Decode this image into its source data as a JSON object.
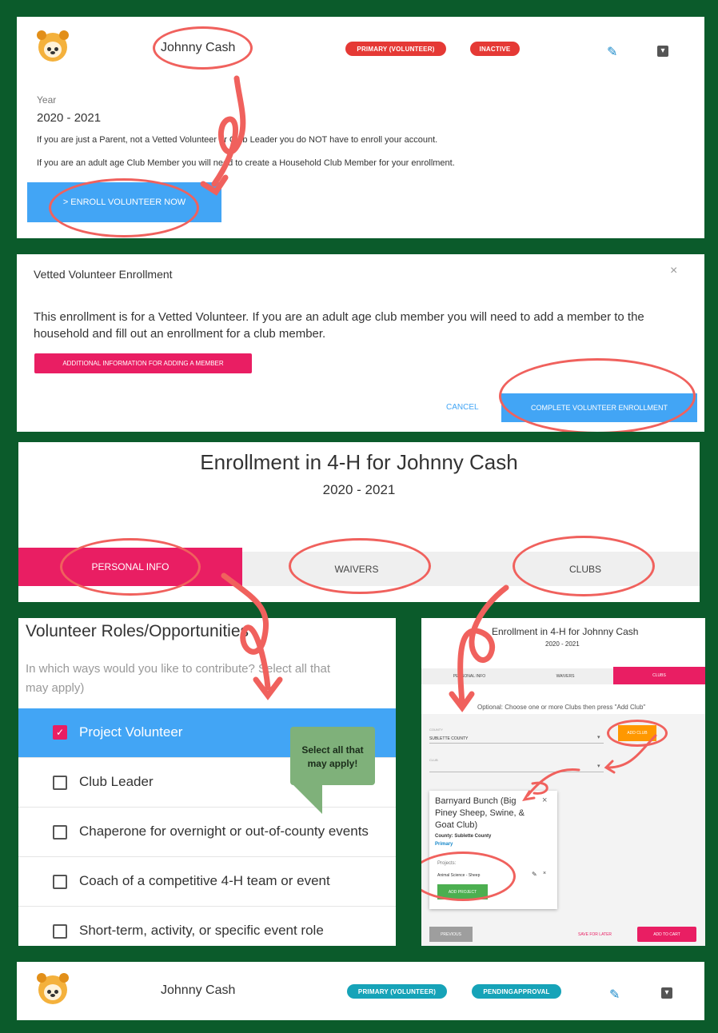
{
  "card1": {
    "name": "Johnny Cash",
    "chip_primary": "PRIMARY (VOLUNTEER)",
    "chip_status": "INACTIVE",
    "year_label": "Year",
    "year_value": "2020 - 2021",
    "note1": "If you are just a Parent, not a Vetted Volunteer or Club Leader you do NOT have to enroll your account.",
    "note2": "If you are an adult age Club Member you will need to create a Household Club Member for your enrollment.",
    "enroll_button": "> ENROLL VOLUNTEER NOW"
  },
  "dialog": {
    "title": "Vetted Volunteer Enrollment",
    "close": "×",
    "body": "This enrollment is for a Vetted Volunteer. If you are an adult age club member you will need to add a member to the household and fill out an enrollment for a club member.",
    "info_button": "ADDITIONAL INFORMATION FOR ADDING A MEMBER",
    "cancel": "CANCEL",
    "complete": "COMPLETE VOLUNTEER ENROLLMENT"
  },
  "enrollment": {
    "title": "Enrollment in 4-H for Johnny Cash",
    "year": "2020 - 2021",
    "tabs": [
      "PERSONAL INFO",
      "WAIVERS",
      "CLUBS"
    ]
  },
  "roles": {
    "heading": "Volunteer Roles/Opportunities",
    "subtitle": "In which ways would you like to contribute? Select all that may apply)",
    "items": [
      {
        "label": "Project Volunteer",
        "checked": true
      },
      {
        "label": "Club Leader",
        "checked": false
      },
      {
        "label": "Chaperone for overnight or out-of-county events",
        "checked": false
      },
      {
        "label": "Coach of a competitive 4-H team or event",
        "checked": false
      },
      {
        "label": "Short-term, activity, or specific event role",
        "checked": false
      }
    ],
    "callout": "Select all that may apply!"
  },
  "clubs": {
    "title": "Enrollment in 4-H for Johnny Cash",
    "year": "2020 - 2021",
    "tabs": [
      "PERSONAL INFO",
      "WAIVERS",
      "CLUBS"
    ],
    "hint": "Optional: Choose one or more Clubs then press \"Add Club\"",
    "county_label": "COUNTY",
    "county_value": "SUBLETTE COUNTY",
    "add_club": "ADD CLUB",
    "club_label": "CLUB",
    "card_title": "Barnyard Bunch (Big Piney Sheep, Swine, & Goat Club)",
    "card_county": "County: Sublette County",
    "card_primary": "Primary",
    "projects_label": "Projects:",
    "project_name": "Animal Science - Sheep",
    "add_project": "ADD PROJECT",
    "previous": "PREVIOUS",
    "save_later": "SAVE FOR LATER",
    "add_cart": "ADD TO CART"
  },
  "card2": {
    "name": "Johnny Cash",
    "chip_primary": "PRIMARY (VOLUNTEER)",
    "chip_status": "PENDINGAPPROVAL"
  },
  "colors": {
    "background": "#0b5b2b",
    "accent_blue": "#42a5f5",
    "accent_pink": "#e91e63",
    "annotation": "#f0615d",
    "chip_red": "#e53935",
    "chip_teal": "#16a3b8"
  }
}
